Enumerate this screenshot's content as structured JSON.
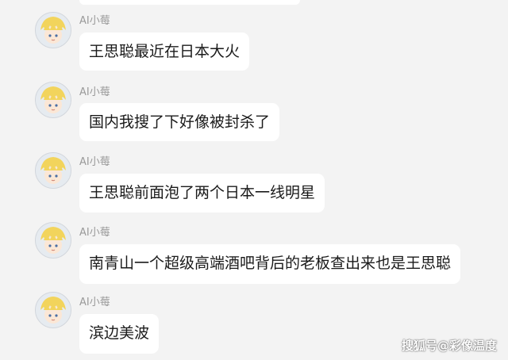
{
  "messages": [
    {
      "sender": "AI小莓",
      "text": "王思聪最近在日本大火"
    },
    {
      "sender": "AI小莓",
      "text": "国内我搜了下好像被封杀了"
    },
    {
      "sender": "AI小莓",
      "text": "王思聪前面泡了两个日本一线明星"
    },
    {
      "sender": "AI小莓",
      "text": "南青山一个超级高端酒吧背后的老板查出来也是王思聪"
    },
    {
      "sender": "AI小莓",
      "text": "滨边美波"
    }
  ],
  "watermark": "搜狐号@彩像温度",
  "icons": {
    "avatar": "anime-avatar-icon"
  },
  "colors": {
    "background": "#f3f3f3",
    "bubble": "#ffffff",
    "sender_name": "#9a9a9a",
    "message_text": "#1a1a1a"
  }
}
